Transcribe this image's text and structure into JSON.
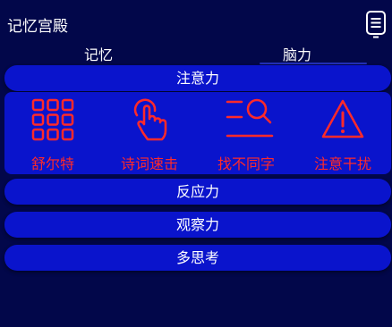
{
  "app": {
    "title": "记忆宫殿"
  },
  "header": {
    "menu_icon": "list-icon"
  },
  "tabs": [
    {
      "label": "记忆",
      "selected": false
    },
    {
      "label": "脑力",
      "selected": true
    }
  ],
  "sections": [
    {
      "label": "注意力",
      "expanded": true
    },
    {
      "label": "反应力",
      "expanded": false
    },
    {
      "label": "观察力",
      "expanded": false
    },
    {
      "label": "多思考",
      "expanded": false
    }
  ],
  "games": [
    {
      "label": "舒尔特",
      "icon": "grid-icon"
    },
    {
      "label": "诗词速击",
      "icon": "tap-hand-icon"
    },
    {
      "label": "找不同字",
      "icon": "search-list-icon"
    },
    {
      "label": "注意干扰",
      "icon": "warning-icon"
    }
  ],
  "colors": {
    "background": "#02074a",
    "pill": "#0a14cc",
    "accent_red": "#ff2a2a",
    "text": "#ffffff"
  }
}
